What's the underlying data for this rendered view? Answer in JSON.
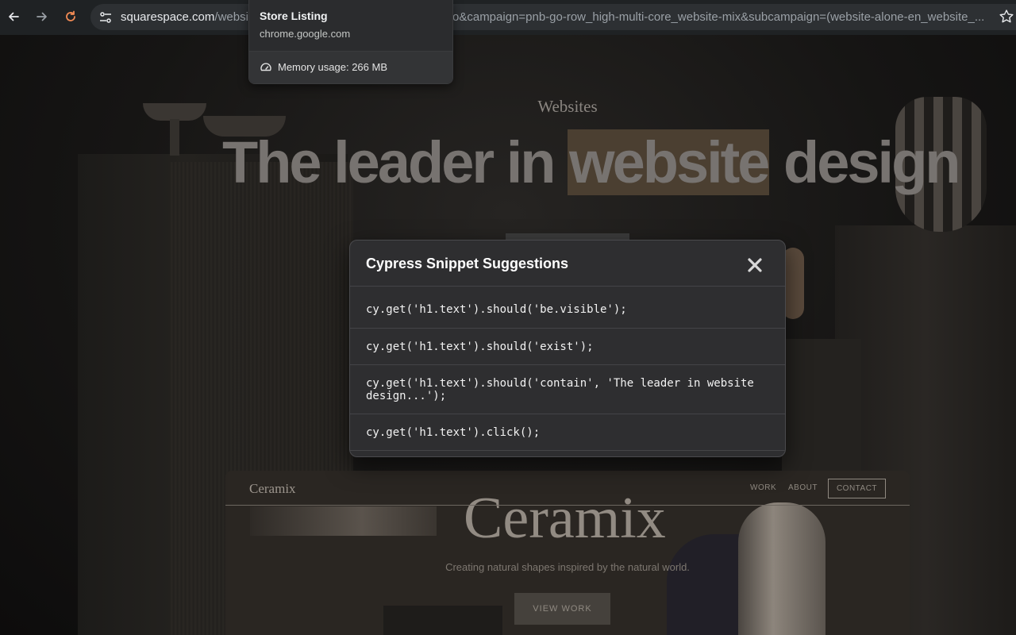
{
  "browser": {
    "url_host": "squarespace.com",
    "url_path_visible": "/websit",
    "url_rest_visible": "o&campaign=pnb-go-row_high-multi-core_website-mix&subcampaign=(website-alone-en_website_...",
    "icons": {
      "back": "arrow-left-icon",
      "forward": "arrow-right-icon",
      "reload": "reload-icon",
      "site_info": "tune-icon",
      "bookmark": "star-icon"
    },
    "reload_color": "#f28b54"
  },
  "hovercard": {
    "title": "Store Listing",
    "domain": "chrome.google.com",
    "memory": "Memory usage: 266 MB"
  },
  "page": {
    "eyebrow": "Websites",
    "headline_before": "The leader in ",
    "headline_highlight": "website",
    "headline_after": " design",
    "highlight_color": "#4b3f31",
    "preview": {
      "logo": "Ceramix",
      "nav": [
        "WORK",
        "ABOUT",
        "CONTACT"
      ],
      "hero": "Ceramix",
      "tagline": "Creating natural shapes inspired by the natural world.",
      "button": "VIEW WORK"
    }
  },
  "modal": {
    "title": "Cypress Snippet Suggestions",
    "close_icon": "close-icon",
    "snippets": [
      "cy.get('h1.text').should('be.visible');",
      "cy.get('h1.text').should('exist');",
      "cy.get('h1.text').should('contain', 'The leader in website design...');",
      "cy.get('h1.text').click();"
    ]
  }
}
